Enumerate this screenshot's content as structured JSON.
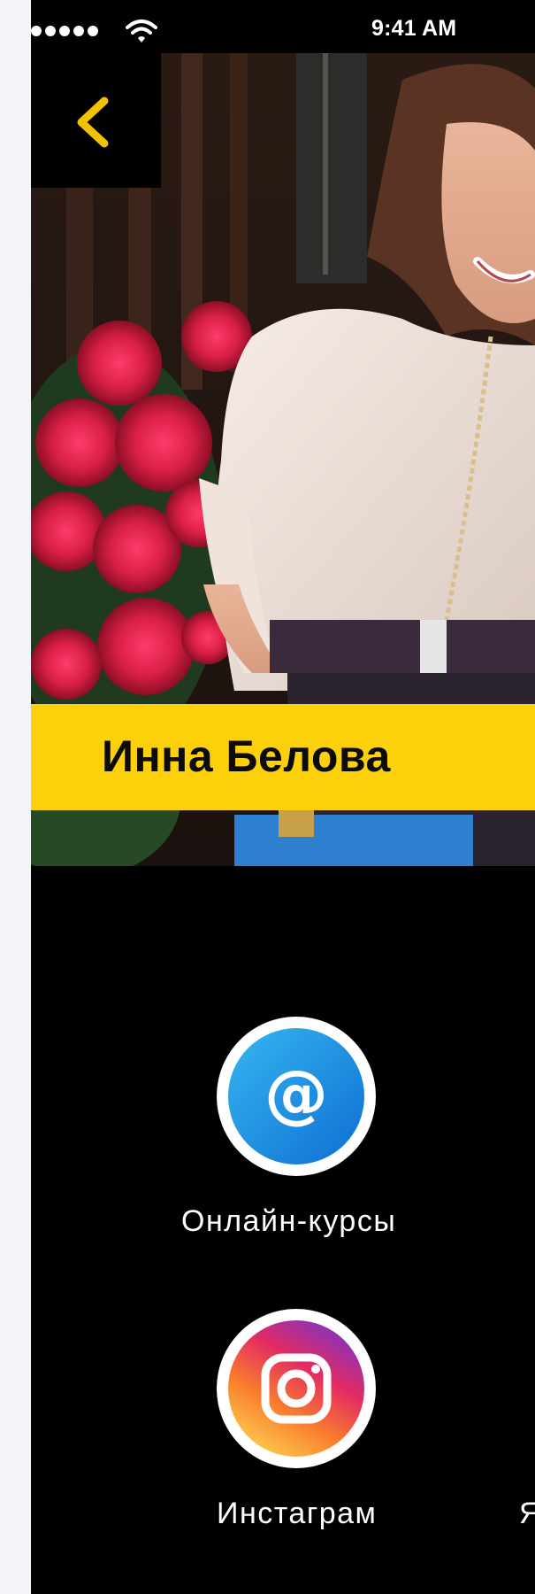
{
  "status_bar": {
    "time": "9:41 AM"
  },
  "profile": {
    "name": "Инна Белова"
  },
  "links": [
    {
      "label": "Онлайн-курсы",
      "icon": "at-sign-icon"
    },
    {
      "label": "Инстаграм",
      "icon": "instagram-icon"
    },
    {
      "label": "Я",
      "icon": "partially-visible-icon"
    }
  ],
  "colors": {
    "accent": "#fcd00a",
    "background": "#000000",
    "back_chevron": "#f2c200"
  }
}
